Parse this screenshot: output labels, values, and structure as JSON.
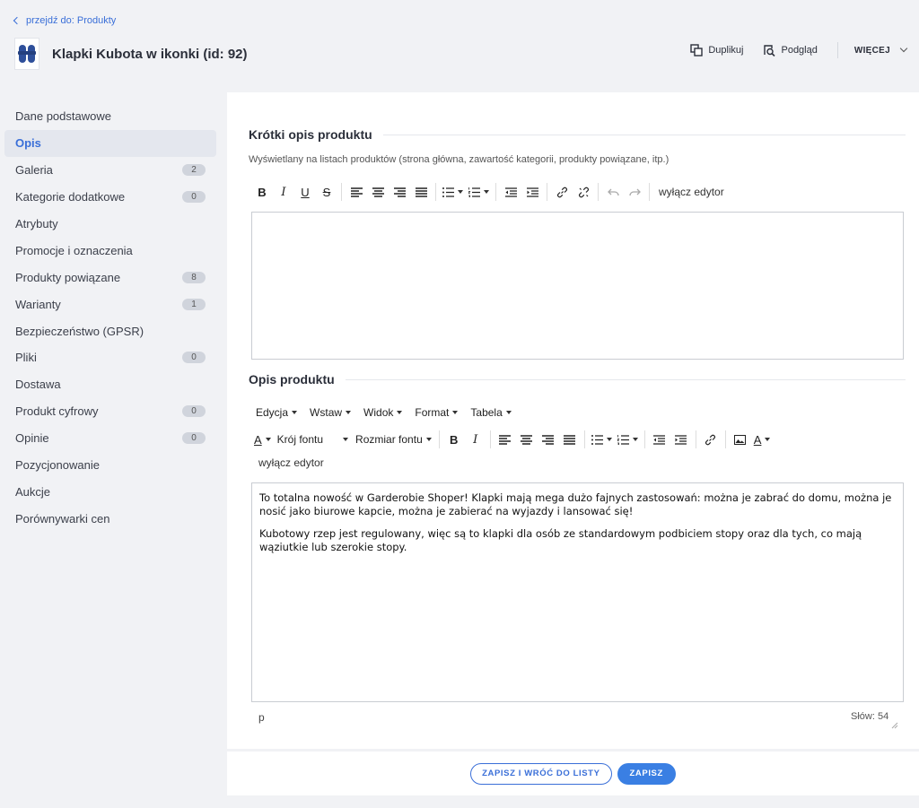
{
  "header": {
    "back_link": "przejdź do: Produkty",
    "product_title": "Klapki Kubota w ikonki (id: 92)",
    "actions": {
      "duplicate": "Duplikuj",
      "preview": "Podgląd",
      "more": "WIĘCEJ"
    }
  },
  "sidebar": {
    "items": [
      {
        "label": "Dane podstawowe",
        "badge": null
      },
      {
        "label": "Opis",
        "badge": null
      },
      {
        "label": "Galeria",
        "badge": "2"
      },
      {
        "label": "Kategorie dodatkowe",
        "badge": "0"
      },
      {
        "label": "Atrybuty",
        "badge": null
      },
      {
        "label": "Promocje i oznaczenia",
        "badge": null
      },
      {
        "label": "Produkty powiązane",
        "badge": "8"
      },
      {
        "label": "Warianty",
        "badge": "1"
      },
      {
        "label": "Bezpieczeństwo (GPSR)",
        "badge": null
      },
      {
        "label": "Pliki",
        "badge": "0"
      },
      {
        "label": "Dostawa",
        "badge": null
      },
      {
        "label": "Produkt cyfrowy",
        "badge": "0"
      },
      {
        "label": "Opinie",
        "badge": "0"
      },
      {
        "label": "Pozycjonowanie",
        "badge": null
      },
      {
        "label": "Aukcje",
        "badge": null
      },
      {
        "label": "Porównywarki cen",
        "badge": null
      }
    ],
    "active_index": 1
  },
  "short_desc": {
    "title": "Krótki opis produktu",
    "hint": "Wyświetlany na listach produktów (strona główna, zawartość kategorii, produkty powiązane, itp.)",
    "disable_editor": "wyłącz edytor",
    "content": ""
  },
  "desc": {
    "title": "Opis produktu",
    "menu": [
      "Edycja",
      "Wstaw",
      "Widok",
      "Format",
      "Tabela"
    ],
    "font_family": "Krój fontu",
    "font_size": "Rozmiar fontu",
    "disable_editor": "wyłącz edytor",
    "paragraphs": [
      "To totalna nowość w  Garderobie Shoper! Klapki mają mega dużo fajnych zastosowań: można je zabrać do domu, można je nosić jako biurowe kapcie, można je zabierać na wyjazdy i lansować się!",
      "Kubotowy rzep jest regulowany, więc są to klapki dla osób ze standardowym podbiciem stopy oraz dla tych, co mają wąziutkie lub szerokie stopy."
    ],
    "status_path": "p",
    "word_count": "Słów: 54"
  },
  "footer": {
    "save_and_back": "ZAPISZ I WRÓĆ DO LISTY",
    "save": "ZAPISZ"
  },
  "colors": {
    "accent": "#3a6fd8",
    "primary_button": "#3a7fe3",
    "page_bg": "#f1f2f5"
  }
}
